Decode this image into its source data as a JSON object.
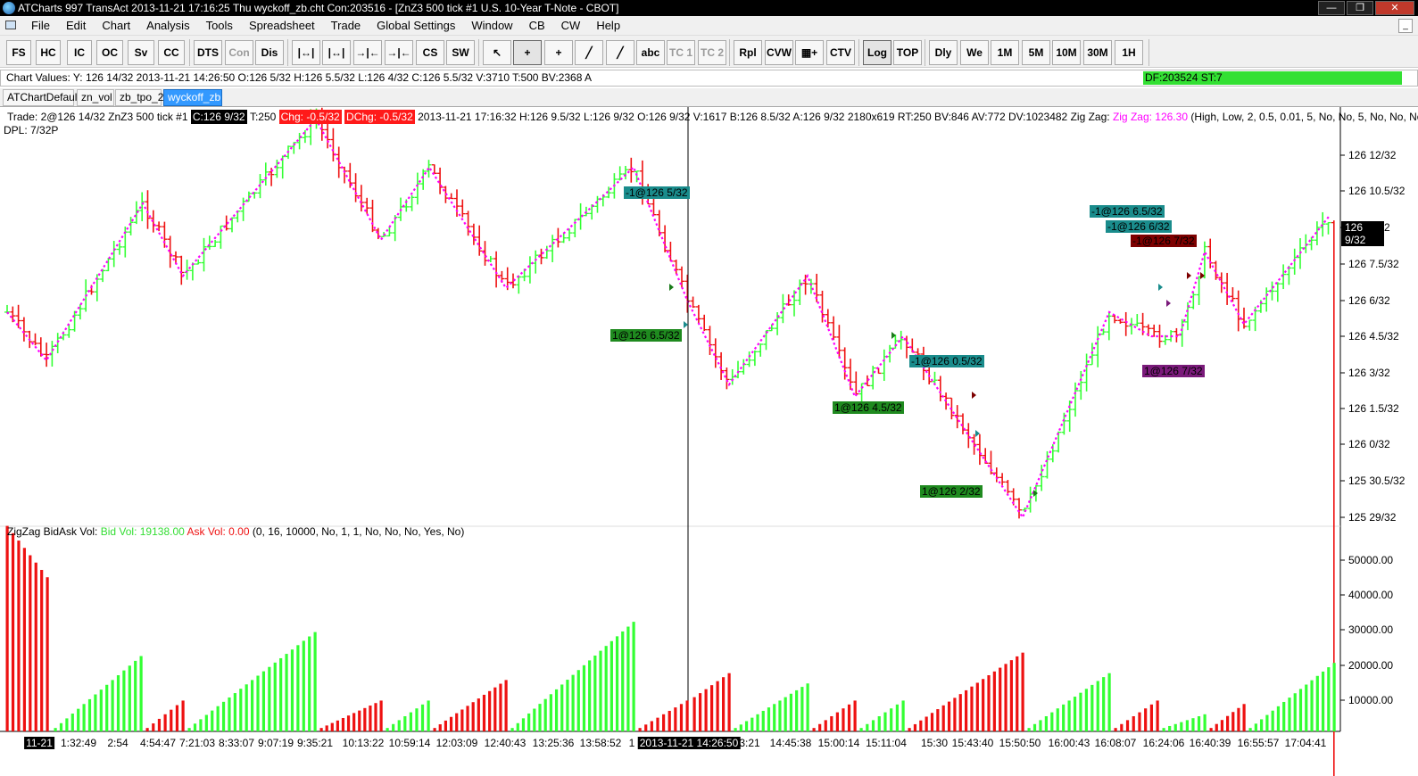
{
  "window": {
    "title": "ATCharts 997 TransAct 2013-11-21  17:16:25 Thu  wyckoff_zb.cht Con:203516 - [ZnZ3  500 tick  #1  U.S. 10-Year T-Note - CBOT]",
    "min": "—",
    "max": "❐",
    "close": "✕"
  },
  "menu": [
    "File",
    "Edit",
    "Chart",
    "Analysis",
    "Tools",
    "Spreadsheet",
    "Trade",
    "Global Settings",
    "Window",
    "CB",
    "CW",
    "Help"
  ],
  "toolbar": {
    "buttons": [
      "FS",
      "HC",
      "IC",
      "OC",
      "Sv",
      "CC",
      "DTS",
      "Con",
      "Dis",
      "|↔|",
      "|↔|",
      "→|←",
      "→|←",
      "CS",
      "SW",
      "↖",
      "+",
      "+",
      "╱",
      "╱",
      "abc",
      "TC 1",
      "TC 2",
      "Rpl",
      "CVW",
      "▦+",
      "CTV",
      "Log",
      "TOP",
      "Dly",
      "We",
      "1M",
      "5M",
      "10M",
      "30M",
      "1H"
    ]
  },
  "infobar": {
    "values": "Chart Values: Y: 126 14/32  2013-11-21  14:26:50  O:126 5/32  H:126 5.5/32  L:126 4/32  C:126 5.5/32  V:3710  T:500  BV:2368  A",
    "df": "DF:203524  ST:7"
  },
  "tabs": [
    "ATChartDefault",
    "zn_vol",
    "zb_tpo_2",
    "wyckoff_zb"
  ],
  "chart": {
    "trade_prefix": "Trade: 2@126 14/32 ZnZ3  500 tick  #1",
    "close": "C:126 9/32",
    "t": "T:250",
    "chg": "Chg: -0.5/32",
    "dchg": "DChg: -0.5/32",
    "trade_rest": "2013-11-21 17:16:32 H:126 9.5/32 L:126 9/32 O:126 9/32 V:1617 B:126 8.5/32 A:126 9/32 2180x619 RT:250 BV:846 AV:772 DV:1023482 Zig Zag:",
    "zz_value": "Zig Zag: 126.30",
    "zz_params": "(High, Low, 2, 0.5, 0.01, 5, No, No, 5, No, No, No, N",
    "dpl": "DPL: 7/32P",
    "price_labels": [
      "126 12/32",
      "126 10.5/32",
      "126 9/32",
      "126 7.5/32",
      "126 6/32",
      "126 4.5/32",
      "126 3/32",
      "126 1.5/32",
      "126 0/32",
      "125 30.5/32",
      "125 29/32"
    ],
    "current_price_label": "126 9/32",
    "vol_labels": [
      "50000.00",
      "40000.00",
      "30000.00",
      "20000.00",
      "10000.00"
    ],
    "time_labels": [
      "11-21",
      "1:32:49",
      "2:54",
      "4:54:47",
      "7:21:03",
      "8:33:07",
      "9:07:19",
      "9:35:21",
      "10:13:22",
      "10:59:14",
      "12:03:09",
      "12:40:43",
      "13:25:36",
      "13:58:52",
      "1",
      "2013-11-21  14:26:50",
      "3:21",
      "14:45:38",
      "15:00:14",
      "15:11:04",
      "15:30",
      "15:43:40",
      "15:50:50",
      "16:00:43",
      "16:08:07",
      "16:24:06",
      "16:40:39",
      "16:55:57",
      "17:04:41"
    ],
    "trade_labels": {
      "l1": "-1@126 5/32",
      "l2": "1@126 6.5/32",
      "l3": "-1@126 0.5/32",
      "l4": "1@126 4.5/32",
      "l5": "1@126 2/32",
      "l6": "-1@126 6.5/32",
      "l7": "-1@126 6/32",
      "l8": "-1@126 7/32",
      "l9": "1@126 7/32"
    },
    "volume_indicator": {
      "name": "ZigZag BidAsk Vol:",
      "bid": "Bid Vol: 19138.00",
      "ask": "Ask Vol: 0.00",
      "params": "(0, 16, 10000, No, 1, 1, No, No, No, Yes, No)"
    },
    "colors": {
      "up_bar": "#33ff33",
      "down_bar": "#ee1111",
      "zigzag": "#ff00ff",
      "crosshair": "#000000"
    }
  },
  "chart_data": {
    "type": "bar",
    "price_scale": {
      "unit": "32nds",
      "min_label": "125 29/32",
      "max_label": "126 12/32"
    },
    "zigzag_points": [
      {
        "time": "11-21",
        "price": "126 5.5/32"
      },
      {
        "price": "126 3.5/32"
      },
      {
        "price": "126 10/32"
      },
      {
        "price": "126 7/32"
      },
      {
        "price": "126 13.5/32"
      },
      {
        "price": "126 8.5/32"
      },
      {
        "price": "126 11.5/32"
      },
      {
        "price": "126 6.5/32"
      },
      {
        "price": "126 11.5/32"
      },
      {
        "time": "14:26:50",
        "price": "126 6/32"
      },
      {
        "price": "126 2.5/32"
      },
      {
        "price": "126 7/32"
      },
      {
        "price": "126 2/32"
      },
      {
        "price": "126 4.5/32"
      },
      {
        "time": "15:50:50",
        "price": "125 29/32"
      },
      {
        "price": "126 5.5/32"
      },
      {
        "price": "126 4.5/32"
      },
      {
        "price": "126 4.5/32"
      },
      {
        "price": "126 8/32"
      },
      {
        "price": "126 5/32"
      },
      {
        "time": "17:04:41",
        "price": "126 9.5/32"
      }
    ],
    "volume": {
      "ylim": [
        0,
        55000
      ],
      "ticks": [
        10000,
        20000,
        30000,
        40000,
        50000
      ]
    }
  }
}
